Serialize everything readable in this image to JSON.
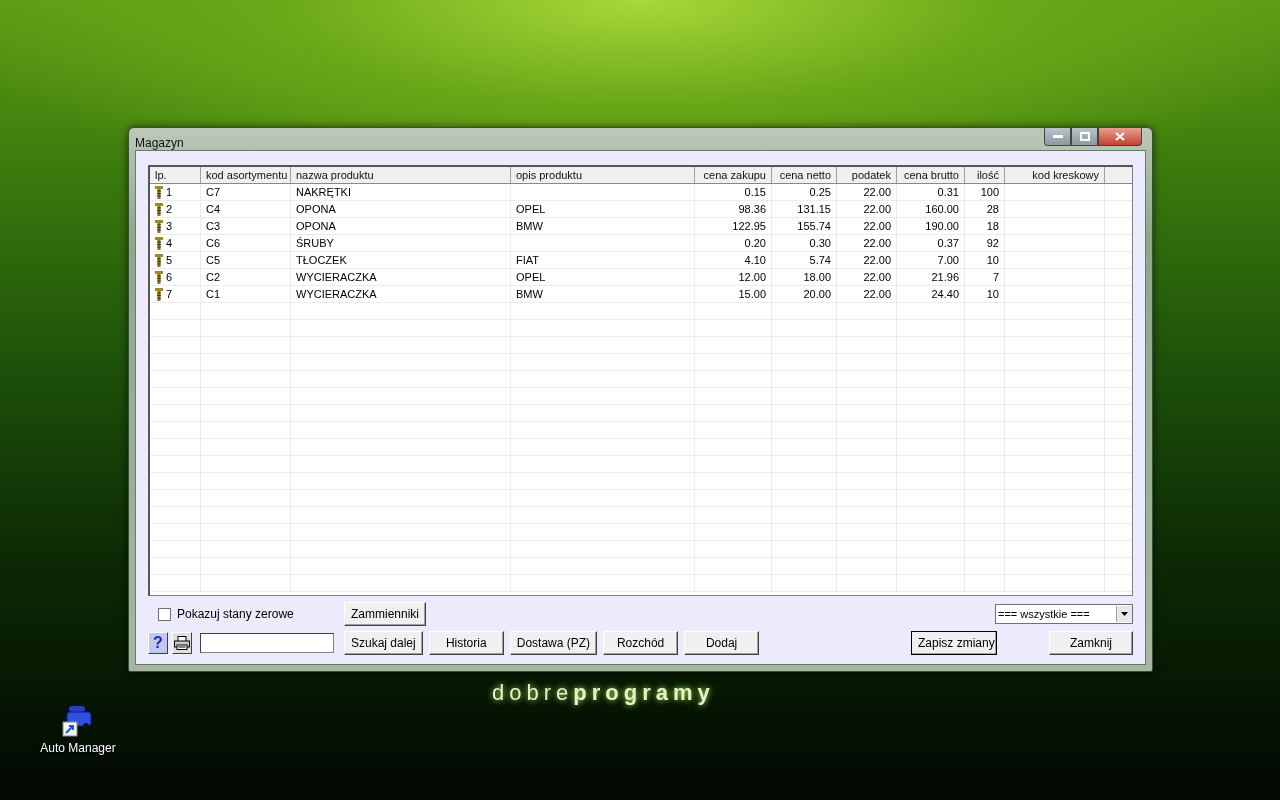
{
  "window": {
    "title": "Magazyn"
  },
  "table": {
    "columns": [
      "lp.",
      "kod asortymentu",
      "nazwa produktu",
      "opis produktu",
      "cena zakupu",
      "cena netto",
      "podatek",
      "cena brutto",
      "ilość",
      "kod kreskowy"
    ],
    "rows": [
      {
        "lp": "1",
        "kod": "C7",
        "nazwa": "NAKRĘTKI",
        "opis": "",
        "cena_zakupu": "0.15",
        "cena_netto": "0.25",
        "podatek": "22.00",
        "cena_brutto": "0.31",
        "ilosc": "100"
      },
      {
        "lp": "2",
        "kod": "C4",
        "nazwa": "OPONA",
        "opis": "OPEL",
        "cena_zakupu": "98.36",
        "cena_netto": "131.15",
        "podatek": "22.00",
        "cena_brutto": "160.00",
        "ilosc": "28"
      },
      {
        "lp": "3",
        "kod": "C3",
        "nazwa": "OPONA",
        "opis": "BMW",
        "cena_zakupu": "122.95",
        "cena_netto": "155.74",
        "podatek": "22.00",
        "cena_brutto": "190.00",
        "ilosc": "18"
      },
      {
        "lp": "4",
        "kod": "C6",
        "nazwa": "ŚRUBY",
        "opis": "",
        "cena_zakupu": "0.20",
        "cena_netto": "0.30",
        "podatek": "22.00",
        "cena_brutto": "0.37",
        "ilosc": "92"
      },
      {
        "lp": "5",
        "kod": "C5",
        "nazwa": "TŁOCZEK",
        "opis": "FIAT",
        "cena_zakupu": "4.10",
        "cena_netto": "5.74",
        "podatek": "22.00",
        "cena_brutto": "7.00",
        "ilosc": "10"
      },
      {
        "lp": "6",
        "kod": "C2",
        "nazwa": "WYCIERACZKA",
        "opis": "OPEL",
        "cena_zakupu": "12.00",
        "cena_netto": "18.00",
        "podatek": "22.00",
        "cena_brutto": "21.96",
        "ilosc": "7"
      },
      {
        "lp": "7",
        "kod": "C1",
        "nazwa": "WYCIERACZKA",
        "opis": "BMW",
        "cena_zakupu": "15.00",
        "cena_netto": "20.00",
        "podatek": "22.00",
        "cena_brutto": "24.40",
        "ilosc": "10"
      }
    ]
  },
  "zero_stock_checkbox": {
    "label": "Pokazuj stany zerowe",
    "checked": false
  },
  "substitutes_button": "Zammienniki",
  "filter_dropdown": {
    "value": "=== wszystkie ==="
  },
  "help_button": "?",
  "action_buttons": [
    "Szukaj dalej",
    "Historia",
    "Dostawa (PZ)",
    "Rozchód",
    "Dodaj"
  ],
  "save_button": "Zapisz zmiany",
  "close_button": "Zamknij",
  "wallpaper_logo": "dobre**programy**",
  "desktop_icon": {
    "label": "Auto Manager"
  }
}
